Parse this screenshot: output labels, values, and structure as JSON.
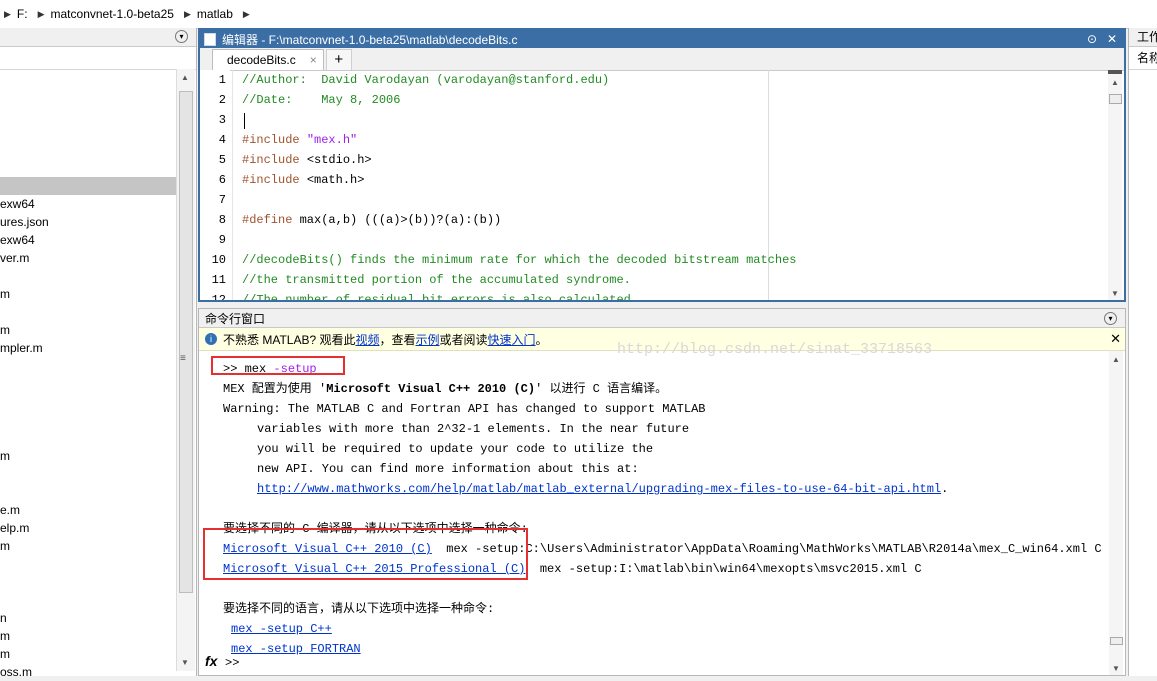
{
  "address_bar": {
    "segments": [
      "F:",
      "matconvnet-1.0-beta25",
      "matlab"
    ]
  },
  "left_panel": {
    "files": [
      "",
      "",
      "",
      "",
      "",
      "",
      "",
      "exw64",
      "ures.json",
      "exw64",
      "ver.m",
      "",
      "m",
      "",
      "m",
      "mpler.m",
      "",
      "",
      "",
      "",
      "",
      "m",
      "",
      "",
      "e.m",
      "elp.m",
      "m",
      "",
      "",
      "",
      "n",
      "m",
      "m",
      "oss.m"
    ],
    "selected_index": 6
  },
  "editor": {
    "title": "编辑器 - F:\\matconvnet-1.0-beta25\\matlab\\decodeBits.c",
    "tab_label": "decodeBits.c",
    "tab_close": "×",
    "tab_add": "+",
    "line_numbers": [
      "1",
      "2",
      "3",
      "4",
      "5",
      "6",
      "7",
      "8",
      "9",
      "10",
      "11",
      "12"
    ],
    "lines": [
      {
        "type": "comment",
        "text": "//Author:  David Varodayan (varodayan@stanford.edu)"
      },
      {
        "type": "comment",
        "text": "//Date:    May 8, 2006"
      },
      {
        "type": "plain",
        "text": ""
      },
      {
        "type": "include",
        "directive": "#include ",
        "arg": "\"mex.h\""
      },
      {
        "type": "include",
        "directive": "#include ",
        "arg": "<stdio.h>"
      },
      {
        "type": "include",
        "directive": "#include ",
        "arg": "<math.h>"
      },
      {
        "type": "plain",
        "text": ""
      },
      {
        "type": "define",
        "directive": "#define ",
        "arg": "max(a,b) (((a)>(b))?(a):(b))"
      },
      {
        "type": "plain",
        "text": ""
      },
      {
        "type": "comment",
        "text": "//decodeBits() finds the minimum rate for which the decoded bitstream matches"
      },
      {
        "type": "comment",
        "text": "//the transmitted portion of the accumulated syndrome."
      },
      {
        "type": "comment",
        "text": "//The number of residual bit errors is also calculated."
      }
    ]
  },
  "command_window": {
    "title": "命令行窗口",
    "info": {
      "prefix": "不熟悉 MATLAB? 观看此",
      "link1": "视频",
      "mid1": "，查看",
      "link2": "示例",
      "mid2": "或者阅读",
      "link3": "快速入门",
      "suffix": "。"
    },
    "watermark": "http://blog.csdn.net/sinat_33718563",
    "prompt_cmd": ">> mex ",
    "prompt_arg": "-setup",
    "output": {
      "line1_a": "MEX 配置为使用 '",
      "line1_b": "Microsoft Visual C++ 2010 (C)",
      "line1_c": "' 以进行 C 语言编译。",
      "warn1": "Warning: The MATLAB C and Fortran API has changed to support MATLAB",
      "warn2": "variables with more than 2^32-1 elements. In the near future",
      "warn3": "you will be required to update your code to utilize the",
      "warn4": "new API. You can find more information about this at:",
      "warn_link": "http://www.mathworks.com/help/matlab/matlab_external/upgrading-mex-files-to-use-64-bit-api.html",
      "warn_link_suffix": ".",
      "choose_compiler": "要选择不同的 C 编译器，请从以下选项中选择一种命令:",
      "compiler1_link": "Microsoft Visual C++ 2010 (C)",
      "compiler1_cmd": "  mex -setup:C:\\Users\\Administrator\\AppData\\Roaming\\MathWorks\\MATLAB\\R2014a\\mex_C_win64.xml C",
      "compiler2_link": "Microsoft Visual C++ 2015 Professional (C)",
      "compiler2_cmd": "  mex -setup:I:\\matlab\\bin\\win64\\mexopts\\msvc2015.xml C",
      "choose_language": "要选择不同的语言，请从以下选项中选择一种命令:",
      "lang1": "mex -setup C++",
      "lang2": "mex -setup FORTRAN"
    },
    "fx": "fx",
    "prompt": ">>"
  },
  "right_panel": {
    "title": "工作",
    "column": "名称"
  },
  "colors": {
    "editor_titlebar": "#3b6ea5",
    "annotation_red": "#e53030",
    "comment_green": "#228b22",
    "link_blue": "#0033cc"
  }
}
